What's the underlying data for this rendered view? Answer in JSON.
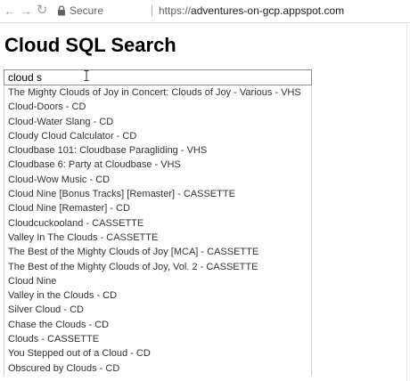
{
  "browser": {
    "back_icon": "arrow-left-icon",
    "forward_icon": "arrow-right-icon",
    "reload_icon": "reload-icon",
    "lock_icon": "lock-icon",
    "secure_label": "Secure",
    "url_scheme": "https://",
    "url_host": "adventures-on-gcp.appspot.com"
  },
  "page": {
    "title": "Cloud SQL Search"
  },
  "search": {
    "value": "cloud s"
  },
  "suggestions": [
    "The Mighty Clouds of Joy in Concert: Clouds of Joy - Various - VHS",
    "Cloud-Doors - CD",
    "Cloud-Water Slang - CD",
    "Cloudy Cloud Calculator - CD",
    "Cloudbase 101: Cloudbase Paragliding - VHS",
    "Cloudbase 6: Party at Cloudbase - VHS",
    "Cloud-Wow Music - CD",
    "Cloud Nine [Bonus Tracks] [Remaster] - CASSETTE",
    "Cloud Nine [Remaster] - CD",
    "Cloudcuckooland - CASSETTE",
    "Valley In The Clouds - CASSETTE",
    "The Best of the Mighty Clouds of Joy [MCA] - CASSETTE",
    "The Best of the Mighty Clouds of Joy, Vol. 2 - CASSETTE",
    "Cloud Nine",
    "Valley in the Clouds - CD",
    "Silver Cloud - CD",
    "Chase the Clouds - CD",
    "Clouds - CASSETTE",
    "You Stepped out of a Cloud - CD",
    "Obscured by Clouds - CD"
  ]
}
